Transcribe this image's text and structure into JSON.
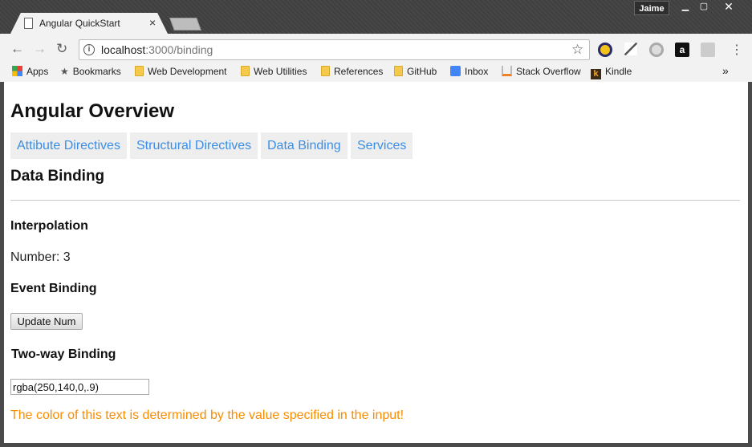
{
  "browser": {
    "tab_title": "Angular QuickStart",
    "tab_close": "×",
    "profile_name": "Jaime",
    "url_host": "localhost",
    "url_path": ":3000/binding",
    "bookmarks": [
      {
        "label": "Apps",
        "icon": "apps-grid-icon"
      },
      {
        "label": "Bookmarks",
        "icon": "star-icon"
      },
      {
        "label": "Web Development",
        "icon": "folder-icon"
      },
      {
        "label": "Web Utilities",
        "icon": "folder-icon"
      },
      {
        "label": "References",
        "icon": "folder-icon"
      },
      {
        "label": "GitHub",
        "icon": "folder-icon"
      },
      {
        "label": "Inbox",
        "icon": "inbox-icon"
      },
      {
        "label": "Stack Overflow",
        "icon": "stackoverflow-icon"
      },
      {
        "label": "Kindle",
        "icon": "kindle-icon"
      }
    ],
    "bookmarks_overflow": "»"
  },
  "page": {
    "title": "Angular Overview",
    "nav": [
      {
        "label": "Attibute Directives"
      },
      {
        "label": "Structural Directives"
      },
      {
        "label": "Data Binding"
      },
      {
        "label": "Services"
      }
    ],
    "section_title": "Data Binding",
    "interpolation": {
      "heading": "Interpolation",
      "number_label": "Number: 3"
    },
    "event_binding": {
      "heading": "Event Binding",
      "button_label": "Update Num"
    },
    "two_way": {
      "heading": "Two-way Binding",
      "input_value": "rgba(250,140,0,.9)",
      "color_text": "The color of this text is determined by the value specified in the input!",
      "text_color": "#fa8c00"
    },
    "link_color": "#3a8ee6"
  }
}
